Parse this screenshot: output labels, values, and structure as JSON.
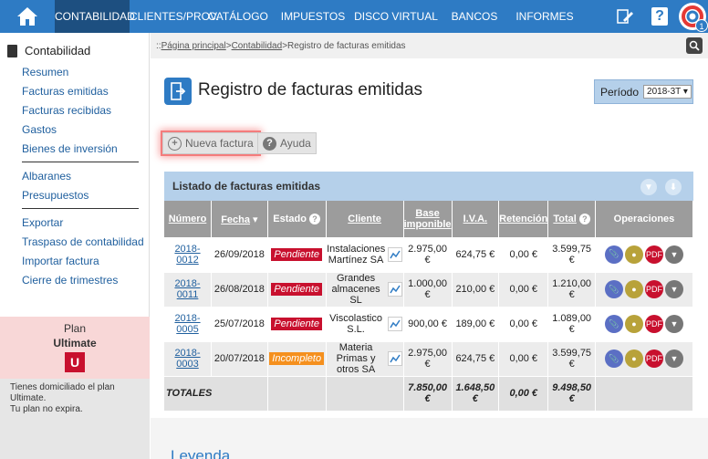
{
  "nav": {
    "items": [
      {
        "label": "CONTABILIDAD",
        "active": true
      },
      {
        "label": "CLIENTES/PROV.",
        "active": false
      },
      {
        "label": "CATÁLOGO",
        "active": false
      },
      {
        "label": "IMPUESTOS",
        "active": false
      },
      {
        "label": "DISCO VIRTUAL",
        "active": false
      },
      {
        "label": "BANCOS",
        "active": false
      },
      {
        "label": "INFORMES",
        "active": false
      }
    ],
    "help_glyph": "?",
    "avatar_badge": "1"
  },
  "sidebar": {
    "section_title": "Contabilidad",
    "group1": [
      "Resumen",
      "Facturas emitidas",
      "Facturas recibidas",
      "Gastos",
      "Bienes de inversión"
    ],
    "group2": [
      "Albaranes",
      "Presupuestos"
    ],
    "group3": [
      "Exportar",
      "Traspaso de contabilidad",
      "Importar factura",
      "Cierre de trimestres"
    ],
    "plan": {
      "label": "Plan",
      "name": "Ultimate",
      "logo_letter": "U"
    },
    "plan_note_line1": "Tienes domiciliado el plan Ultimate.",
    "plan_note_line2": "Tu plan no expira."
  },
  "breadcrumb": {
    "prefix": ":: ",
    "home": "Página principal",
    "sep": " > ",
    "section": "Contabilidad",
    "current": "Registro de facturas emitidas"
  },
  "page": {
    "title": "Registro de facturas emitidas",
    "period_label": "Período",
    "period_value": "2018-3T ▾"
  },
  "buttons": {
    "new_invoice": "Nueva factura",
    "help": "Ayuda"
  },
  "listing": {
    "title": "Listado de facturas emitidas",
    "headers": {
      "numero": "Número",
      "fecha": "Fecha",
      "estado": "Estado",
      "cliente": "Cliente",
      "base": "Base imponible",
      "iva": "I.V.A.",
      "retencion": "Retención",
      "total": "Total",
      "ops": "Operaciones"
    },
    "rows": [
      {
        "numero": "2018-0012",
        "fecha": "26/09/2018",
        "estado": "Pendiente",
        "cliente": "Instalaciones Martínez SA",
        "base": "2.975,00 €",
        "iva": "624,75 €",
        "retencion": "0,00 €",
        "total": "3.599,75 €"
      },
      {
        "numero": "2018-0011",
        "fecha": "26/08/2018",
        "estado": "Pendiente",
        "cliente": "Grandes almacenes SL",
        "base": "1.000,00 €",
        "iva": "210,00 €",
        "retencion": "0,00 €",
        "total": "1.210,00 €"
      },
      {
        "numero": "2018-0005",
        "fecha": "25/07/2018",
        "estado": "Pendiente",
        "cliente": "Viscolastico S.L.",
        "base": "900,00 €",
        "iva": "189,00 €",
        "retencion": "0,00 €",
        "total": "1.089,00 €"
      },
      {
        "numero": "2018-0003",
        "fecha": "20/07/2018",
        "estado": "Incompleto",
        "cliente": "Materia Primas y otros SA",
        "base": "2.975,00 €",
        "iva": "624,75 €",
        "retencion": "0,00 €",
        "total": "3.599,75 €"
      }
    ],
    "totals": {
      "label": "TOTALES",
      "base": "7.850,00 €",
      "iva": "1.648,50 €",
      "retencion": "0,00 €",
      "total": "9.498,50 €"
    }
  },
  "legend_title": "Leyenda",
  "colors": {
    "nav": "#2e7bc4",
    "nav_active": "#1d4f80",
    "pendiente": "#c8102e",
    "incompleto": "#f5901e",
    "panel": "#b5d0ea"
  }
}
